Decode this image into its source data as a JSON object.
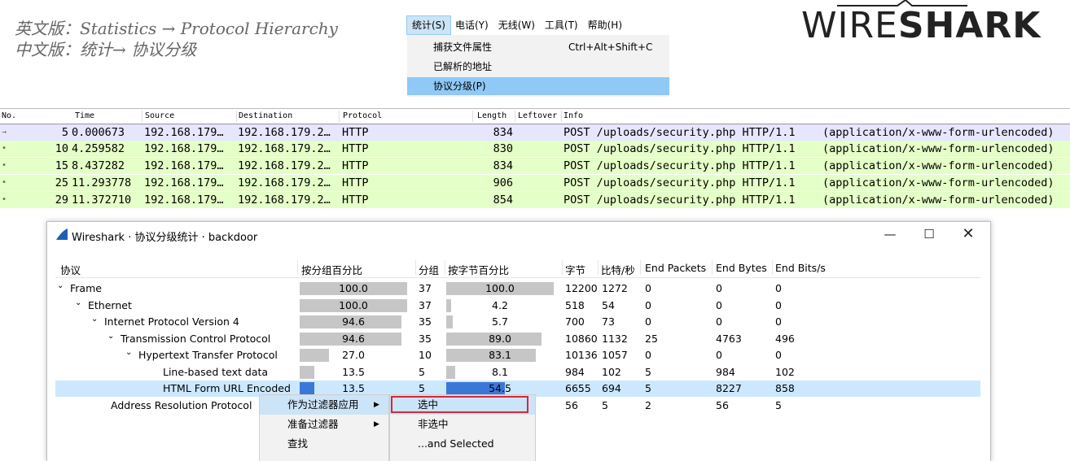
{
  "caption": {
    "english": "英文版：Statistics → Protocol Hierarchy",
    "chinese": "中文版：统计→ 协议分级"
  },
  "menubar": {
    "items": [
      "统计(S)",
      "电话(Y)",
      "无线(W)",
      "工具(T)",
      "帮助(H)"
    ]
  },
  "stats_menu": {
    "items": [
      {
        "label": "捕获文件属性",
        "shortcut": "Ctrl+Alt+Shift+C"
      },
      {
        "label": "已解析的地址",
        "shortcut": ""
      },
      {
        "label": "协议分级(P)",
        "shortcut": ""
      }
    ]
  },
  "logo": {
    "thin": "WIRE",
    "bold": "SHARK"
  },
  "packet_list": {
    "columns": [
      "No.",
      "Time",
      "Source",
      "Destination",
      "Protocol",
      "Length",
      "Leftover",
      "Info"
    ],
    "rows": [
      {
        "no": "5",
        "time": "0.000673",
        "src": "192.168.179…",
        "dst": "192.168.179.2…",
        "proto": "HTTP",
        "len": "834",
        "info": "POST /uploads/security.php HTTP/1.1",
        "extra": "(application/x-www-form-urlencoded)"
      },
      {
        "no": "10",
        "time": "4.259582",
        "src": "192.168.179…",
        "dst": "192.168.179.2…",
        "proto": "HTTP",
        "len": "830",
        "info": "POST /uploads/security.php HTTP/1.1",
        "extra": "(application/x-www-form-urlencoded)"
      },
      {
        "no": "15",
        "time": "8.437282",
        "src": "192.168.179…",
        "dst": "192.168.179.2…",
        "proto": "HTTP",
        "len": "834",
        "info": "POST /uploads/security.php HTTP/1.1",
        "extra": "(application/x-www-form-urlencoded)"
      },
      {
        "no": "25",
        "time": "11.293778",
        "src": "192.168.179…",
        "dst": "192.168.179.2…",
        "proto": "HTTP",
        "len": "906",
        "info": "POST /uploads/security.php HTTP/1.1",
        "extra": "(application/x-www-form-urlencoded)"
      },
      {
        "no": "29",
        "time": "11.372710",
        "src": "192.168.179…",
        "dst": "192.168.179.2…",
        "proto": "HTTP",
        "len": "854",
        "info": "POST /uploads/security.php HTTP/1.1",
        "extra": "(application/x-www-form-urlencoded)"
      }
    ]
  },
  "dialog": {
    "title": "Wireshark · 协议分级统计 · backdoor",
    "columns": [
      "协议",
      "按分组百分比",
      "分组",
      "按字节百分比",
      "字节",
      "比特/秒",
      "End Packets",
      "End Bytes",
      "End Bits/s"
    ],
    "rows": [
      {
        "name": "Frame",
        "pkt_pct": "100.0",
        "pkts": "37",
        "byte_pct": "100.0",
        "bytes": "12200",
        "bps": "1272",
        "end_pkts": "0",
        "end_bytes": "0",
        "end_bps": "0",
        "pkt_frac": 1.0,
        "byte_frac": 1.0
      },
      {
        "name": "Ethernet",
        "pkt_pct": "100.0",
        "pkts": "37",
        "byte_pct": "4.2",
        "bytes": "518",
        "bps": "54",
        "end_pkts": "0",
        "end_bytes": "0",
        "end_bps": "0",
        "pkt_frac": 1.0,
        "byte_frac": 0.042
      },
      {
        "name": "Internet Protocol Version 4",
        "pkt_pct": "94.6",
        "pkts": "35",
        "byte_pct": "5.7",
        "bytes": "700",
        "bps": "73",
        "end_pkts": "0",
        "end_bytes": "0",
        "end_bps": "0",
        "pkt_frac": 0.946,
        "byte_frac": 0.057
      },
      {
        "name": "Transmission Control Protocol",
        "pkt_pct": "94.6",
        "pkts": "35",
        "byte_pct": "89.0",
        "bytes": "10860",
        "bps": "1132",
        "end_pkts": "25",
        "end_bytes": "4763",
        "end_bps": "496",
        "pkt_frac": 0.946,
        "byte_frac": 0.89
      },
      {
        "name": "Hypertext Transfer Protocol",
        "pkt_pct": "27.0",
        "pkts": "10",
        "byte_pct": "83.1",
        "bytes": "10136",
        "bps": "1057",
        "end_pkts": "0",
        "end_bytes": "0",
        "end_bps": "0",
        "pkt_frac": 0.27,
        "byte_frac": 0.831
      },
      {
        "name": "Line-based text data",
        "pkt_pct": "13.5",
        "pkts": "5",
        "byte_pct": "8.1",
        "bytes": "984",
        "bps": "102",
        "end_pkts": "5",
        "end_bytes": "984",
        "end_bps": "102",
        "pkt_frac": 0.135,
        "byte_frac": 0.081
      },
      {
        "name": "HTML Form URL Encoded",
        "pkt_pct": "13.5",
        "pkts": "5",
        "byte_pct": "54.5",
        "bytes": "6655",
        "bps": "694",
        "end_pkts": "5",
        "end_bytes": "8227",
        "end_bps": "858",
        "pkt_frac": 0.135,
        "byte_frac": 0.545
      },
      {
        "name": "Address Resolution Protocol",
        "pkt_pct": "",
        "pkts": "",
        "byte_pct": "",
        "bytes": "56",
        "bps": "5",
        "end_pkts": "2",
        "end_bytes": "56",
        "end_bps": "5",
        "pkt_frac": 0,
        "byte_frac": 0
      }
    ]
  },
  "context_menu": {
    "items": [
      {
        "label": "作为过滤器应用",
        "arrow": "▶"
      },
      {
        "label": "准备过滤器",
        "arrow": "▶"
      },
      {
        "label": "查找",
        "arrow": ""
      }
    ]
  },
  "submenu": {
    "items": [
      "选中",
      "非选中",
      "...and Selected"
    ]
  },
  "colors": {
    "http_row": "#e4ffc7",
    "first_row": "#e7e6ff",
    "selection": "#cce8ff",
    "bar": "#c6c6c6",
    "bar_highlight": "#3a78d8",
    "menu_highlight": "#90c8f6",
    "red_highlight": "#d3283d"
  }
}
